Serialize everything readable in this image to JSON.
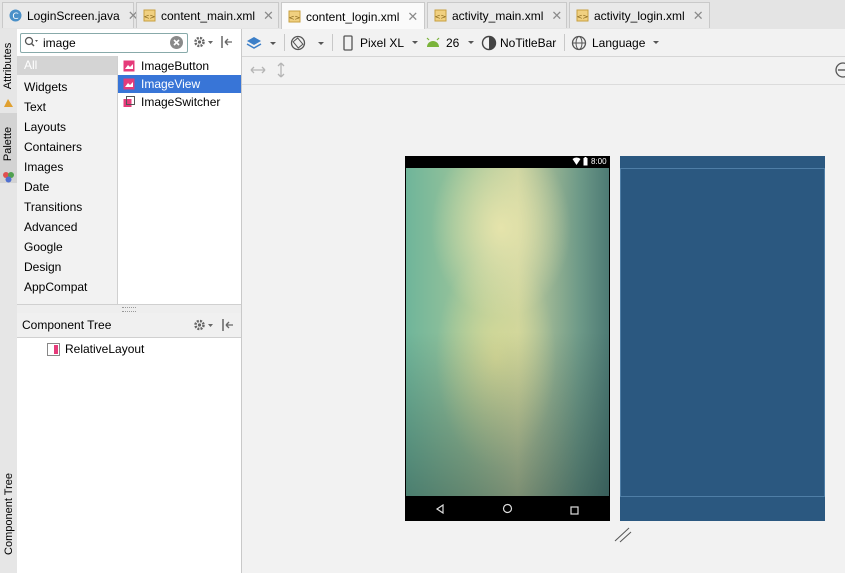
{
  "tabs": [
    {
      "label": "LoginScreen.java",
      "icon": "java-class-icon",
      "active": false
    },
    {
      "label": "content_main.xml",
      "icon": "xml-file-icon",
      "active": false
    },
    {
      "label": "content_login.xml",
      "icon": "xml-file-icon",
      "active": true
    },
    {
      "label": "activity_main.xml",
      "icon": "xml-file-icon",
      "active": false
    },
    {
      "label": "activity_login.xml",
      "icon": "xml-file-icon",
      "active": false
    }
  ],
  "side_tabs": {
    "attributes": "Attributes",
    "palette": "Palette",
    "component_tree": "Component Tree"
  },
  "palette": {
    "search_value": "image",
    "categories": [
      "All",
      "Widgets",
      "Text",
      "Layouts",
      "Containers",
      "Images",
      "Date",
      "Transitions",
      "Advanced",
      "Google",
      "Design",
      "AppCompat"
    ],
    "selected_category": "All",
    "items": [
      "ImageButton",
      "ImageView",
      "ImageSwitcher"
    ],
    "selected_item": "ImageView"
  },
  "component_tree": {
    "title": "Component Tree",
    "nodes": [
      "RelativeLayout"
    ]
  },
  "toolbar": {
    "device": "Pixel XL",
    "api_level": "26",
    "theme": "NoTitleBar",
    "language": "Language"
  },
  "preview": {
    "status_time": "8:00"
  },
  "colors": {
    "accent_selection": "#3875d7",
    "blueprint": "#2b5880",
    "phone_frame": "#000000"
  }
}
